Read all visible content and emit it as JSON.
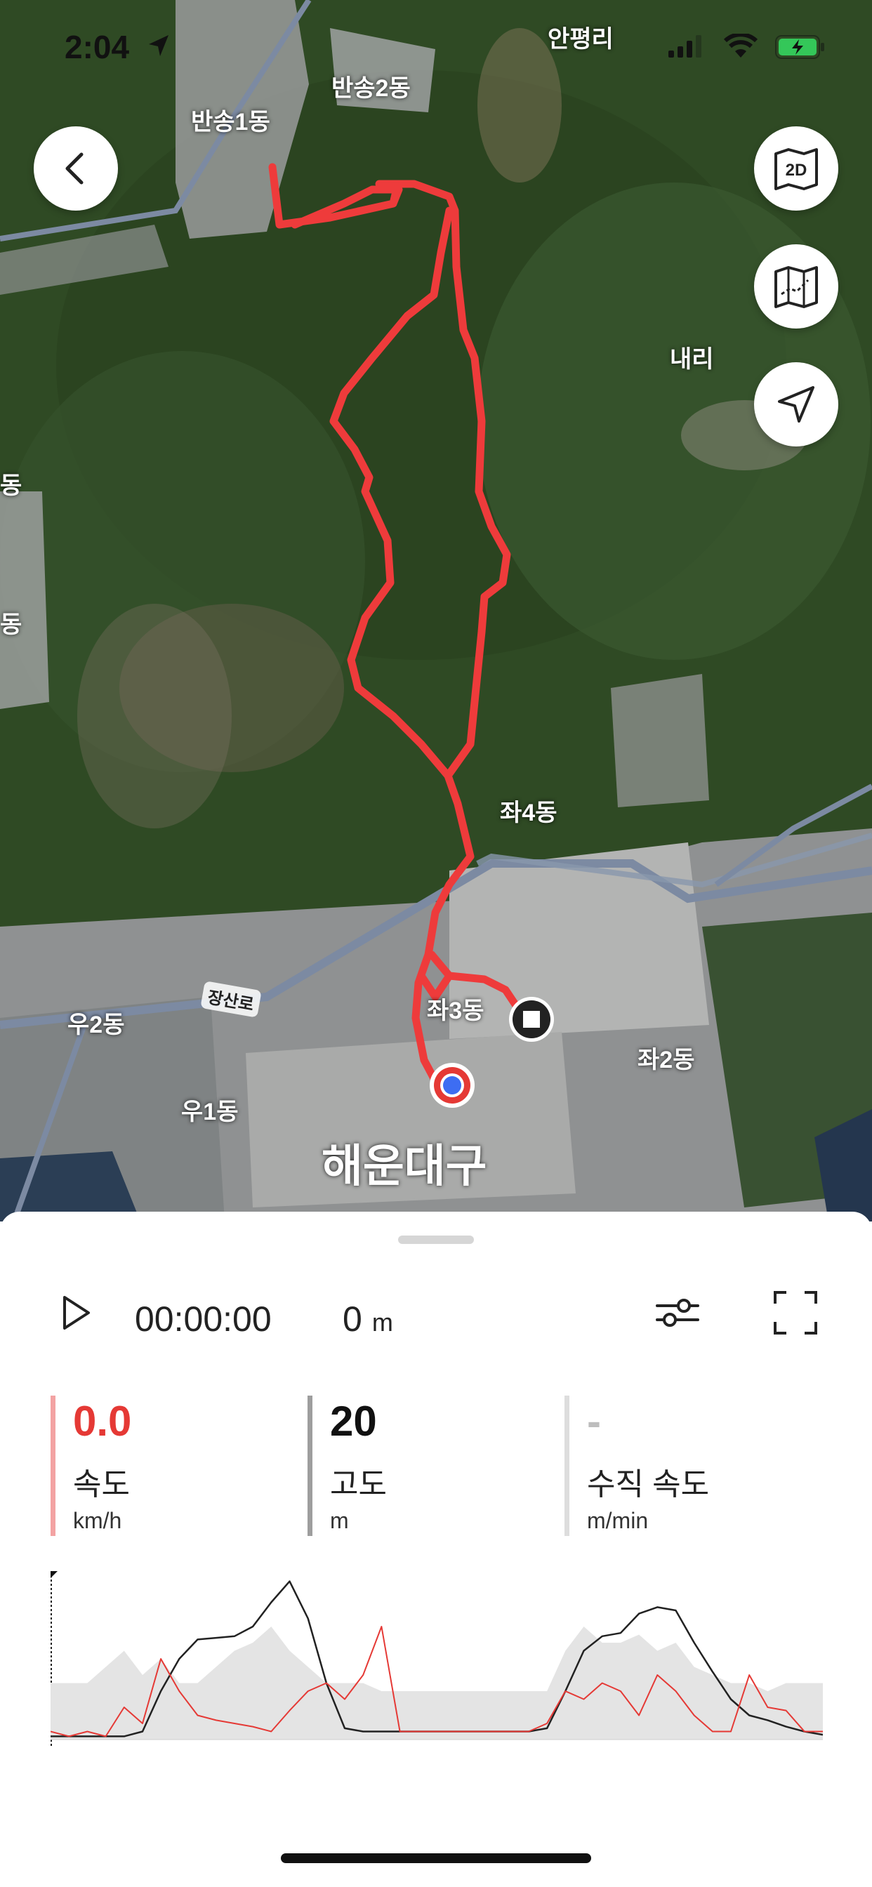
{
  "status_bar": {
    "time": "2:04"
  },
  "map": {
    "labels": {
      "anpyeong": "안평리",
      "bansong2": "반송2동",
      "bansong1": "반송1동",
      "nae": "내리",
      "left_edge_1": "동",
      "left_edge_2": "동",
      "jwa4": "좌4동",
      "jangsanro": "장산로",
      "u2": "우2동",
      "jwa3": "좌3동",
      "jwa2": "좌2동",
      "u1": "우1동",
      "haeundae": "해운대구"
    },
    "route_color": "#ee3b3b"
  },
  "buttons": {
    "back": "back",
    "view_2d": "2D"
  },
  "playback": {
    "elapsed": "00:00:00",
    "distance_value": "0",
    "distance_unit": "m"
  },
  "stats": [
    {
      "value": "0.0",
      "name": "속도",
      "unit": "km/h",
      "color": "#e53935",
      "bar_color": "#f3a3a3"
    },
    {
      "value": "20",
      "name": "고도",
      "unit": "m",
      "color": "#111111",
      "bar_color": "#9e9e9e"
    },
    {
      "value": "-",
      "name": "수직 속도",
      "unit": "m/min",
      "color": "#bdbdbd",
      "bar_color": "#dddddd"
    }
  ],
  "chart_data": {
    "type": "line",
    "title": "",
    "xlabel": "",
    "ylabel": "",
    "series": [
      {
        "values": [
          0.02,
          0.02,
          0.02,
          0.02,
          0.02,
          0.05,
          0.3,
          0.5,
          0.62,
          0.63,
          0.64,
          0.7,
          0.85,
          0.98,
          0.75,
          0.35,
          0.07,
          0.05,
          0.05,
          0.05,
          0.05,
          0.05,
          0.05,
          0.05,
          0.05,
          0.05,
          0.05,
          0.07,
          0.3,
          0.55,
          0.64,
          0.66,
          0.78,
          0.82,
          0.8,
          0.6,
          0.42,
          0.25,
          0.15,
          0.12,
          0.08,
          0.05,
          0.03
        ]
      },
      {
        "values": [
          0.05,
          0.02,
          0.05,
          0.02,
          0.2,
          0.1,
          0.5,
          0.3,
          0.15,
          0.12,
          0.1,
          0.08,
          0.05,
          0.18,
          0.3,
          0.35,
          0.25,
          0.4,
          0.7,
          0.05,
          0.05,
          0.05,
          0.05,
          0.05,
          0.05,
          0.05,
          0.05,
          0.1,
          0.3,
          0.25,
          0.35,
          0.3,
          0.15,
          0.4,
          0.3,
          0.15,
          0.05,
          0.05,
          0.4,
          0.2,
          0.18,
          0.05,
          0.05
        ]
      },
      {
        "values": [
          0.35,
          0.35,
          0.35,
          0.45,
          0.55,
          0.4,
          0.5,
          0.35,
          0.35,
          0.45,
          0.55,
          0.6,
          0.7,
          0.55,
          0.45,
          0.35,
          0.35,
          0.35,
          0.3,
          0.3,
          0.3,
          0.3,
          0.3,
          0.3,
          0.3,
          0.3,
          0.3,
          0.3,
          0.55,
          0.7,
          0.6,
          0.6,
          0.65,
          0.55,
          0.6,
          0.45,
          0.4,
          0.35,
          0.35,
          0.3,
          0.35,
          0.35,
          0.35
        ]
      }
    ]
  }
}
